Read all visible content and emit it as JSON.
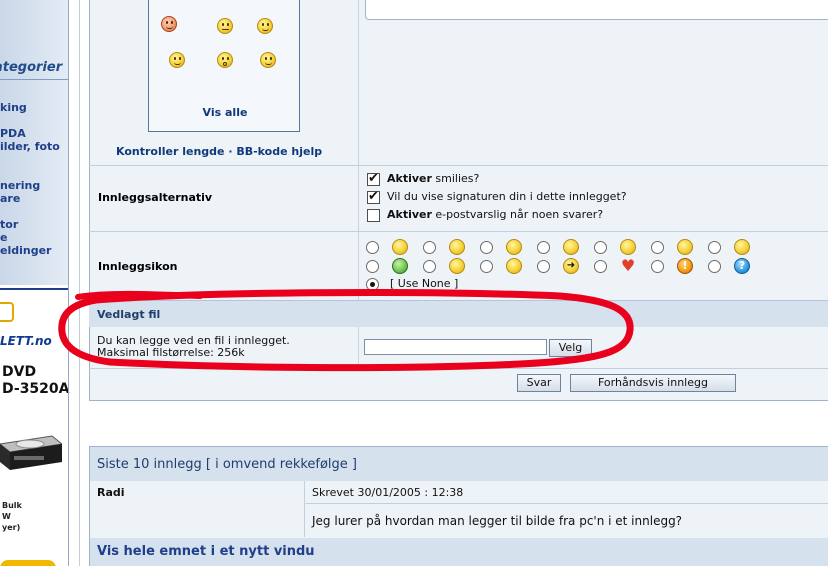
{
  "sidebar": {
    "category_title": "ategorier",
    "links": [
      "king",
      "PDA",
      "ilder, foto",
      "nering",
      "are",
      "tor",
      "e",
      "eldinger"
    ],
    "ad": {
      "logo": "LETT.no",
      "product_line1": "DVD",
      "product_line2": "D-3520A",
      "bulk_lines": [
        "Bulk",
        "W",
        "yer)"
      ]
    }
  },
  "smilies": {
    "vis_alle": "Vis alle",
    "links": "Kontroller lengde · BB-kode hjelp"
  },
  "options": {
    "label": "Innleggsalternativ",
    "items": [
      {
        "bold": "Aktiver",
        "text": " smilies?",
        "checked": true
      },
      {
        "bold": "",
        "text": "Vil du vise signaturen din i dette innlegget?",
        "checked": true
      },
      {
        "bold": "Aktiver",
        "text": " e-postvarslig når noen svarer?",
        "checked": false
      }
    ]
  },
  "post_icons": {
    "label": "Innleggsikon",
    "row1": [
      "smile",
      "confused",
      "wink",
      "grin",
      "surprised",
      "biggrin",
      "mad"
    ],
    "row2": [
      "sick",
      "tongue",
      "cool",
      "arrow",
      "heart",
      "exclamation",
      "question"
    ],
    "use_none": "[ Use None ]",
    "use_none_selected": true
  },
  "attachment": {
    "header": "Vedlagt fil",
    "description_line1": "Du kan legge ved en fil i innlegget.",
    "description_line2": "Maksimal filstørrelse: 256k",
    "file_value": "",
    "browse_label": "Velg"
  },
  "actions": {
    "submit_label": "Svar",
    "preview_label": "Forhåndsvis innlegg"
  },
  "recent": {
    "header": "Siste 10 innlegg [ i omvend rekkefølge ]",
    "posts": [
      {
        "author": "Radi",
        "meta": "Skrevet 30/01/2005 : 12:38",
        "body": "Jeg lurer på hvordan man legger til bilde fra pc'n i et innlegg?"
      }
    ],
    "footer_link": "Vis hele emnet i et nytt vindu"
  },
  "colors": {
    "panel_bg": "#eef3f8",
    "header_bg": "#d6e1ee",
    "link_blue": "#0f3a7a",
    "annotation_red": "#e8001c"
  }
}
